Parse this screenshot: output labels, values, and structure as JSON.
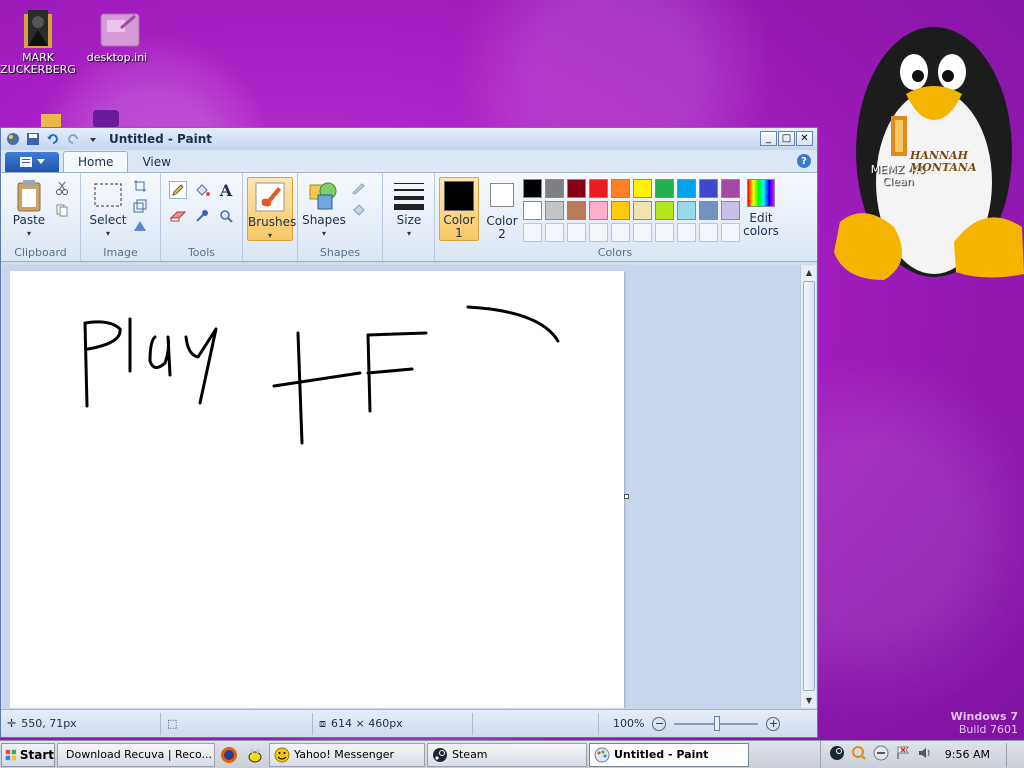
{
  "desktop": {
    "icons": [
      {
        "label": "MARK\nZUCKERBERG",
        "icon": "folder-person-icon"
      },
      {
        "label": "desktop.ini",
        "icon": "ini-file-icon"
      },
      {
        "label": "MEMZ 4.0\nClean",
        "icon": "folder-icon"
      }
    ],
    "watermark": {
      "line1": "Windows 7",
      "line2": "Build 7601"
    },
    "wallpaper_logo_text": "HANNAH MONTANA"
  },
  "paint": {
    "title": "Untitled - Paint",
    "tabs": [
      "Home",
      "View"
    ],
    "groups": {
      "clipboard": {
        "label": "Clipboard",
        "paste": "Paste"
      },
      "image": {
        "label": "Image",
        "select": "Select"
      },
      "tools": {
        "label": "Tools"
      },
      "brushes": {
        "label": "Brushes"
      },
      "shapes": {
        "label": "Shapes",
        "shapes": "Shapes"
      },
      "size": {
        "label": "Size"
      },
      "colors": {
        "label": "Colors",
        "color1": "Color\n1",
        "color2": "Color\n2",
        "edit": "Edit\ncolors",
        "palette_row1": [
          "#000000",
          "#7f7f7f",
          "#880015",
          "#ed1c24",
          "#ff7f27",
          "#fff200",
          "#22b14c",
          "#00a2e8",
          "#3f48cc",
          "#a349a4"
        ],
        "palette_row2": [
          "#ffffff",
          "#c3c3c3",
          "#b97a57",
          "#ffaec9",
          "#ffc90e",
          "#efe4b0",
          "#b5e61d",
          "#99d9ea",
          "#7092be",
          "#c8bfe7"
        ],
        "color1_value": "#000000",
        "color2_value": "#ffffff"
      }
    },
    "canvas_text_drawn": "Play TF",
    "status": {
      "cursor_pos": "550, 71px",
      "selection": "",
      "canvas_size": "614 × 460px",
      "zoom": "100%"
    }
  },
  "taskbar": {
    "start": "Start",
    "items": [
      {
        "label": "Download Recuva | Reco...",
        "icon": "chrome-icon",
        "active": false
      },
      {
        "label": "Yahoo! Messenger",
        "icon": "yahoo-messenger-icon",
        "active": false
      },
      {
        "label": "Steam",
        "icon": "steam-icon",
        "active": false
      },
      {
        "label": "Untitled - Paint",
        "icon": "paint-icon",
        "active": true
      }
    ],
    "clock": "9:56 AM"
  }
}
